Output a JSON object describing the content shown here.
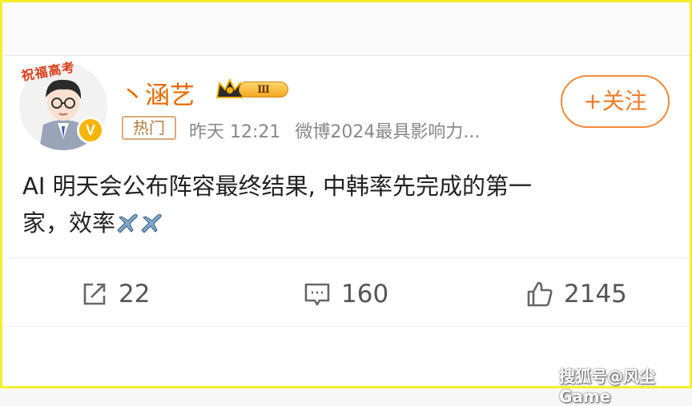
{
  "user": {
    "name": "丶涵艺",
    "level_badge": "Ⅲ",
    "avatar_caption": "祝福高考"
  },
  "post_meta": {
    "hot_tag": "热门",
    "time": "昨天 12:21",
    "source": "微博2024最具影响力..."
  },
  "follow_button": {
    "label": "+关注"
  },
  "post": {
    "line1": "AI 明天会公布阵容最终结果, 中韩率先完成的第一",
    "line2": "家，效率"
  },
  "actions": {
    "repost_count": "22",
    "comment_count": "160",
    "like_count": "2145"
  },
  "watermark": "搜狐号@风尘Game",
  "colors": {
    "frame": "#f3ef2f",
    "username": "#e36a00",
    "follow": "#ee7a2a",
    "hot_tag": "#b67c3e"
  }
}
